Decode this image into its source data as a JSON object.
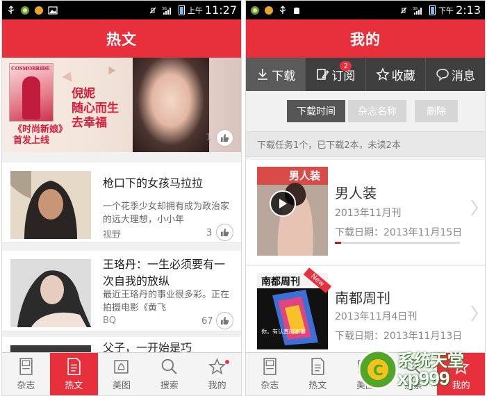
{
  "left_screen": {
    "statusbar": {
      "ampm": "上午",
      "time": "11:27"
    },
    "title": "热文",
    "banner": {
      "magazine_name": "COSMOBRIDE",
      "tagline_1": "倪妮",
      "tagline_2": "随心而生",
      "tagline_3": "去幸福",
      "subtitle_1": "《时尚新娘》",
      "subtitle_2": "首发上线",
      "likes": "1"
    },
    "articles": [
      {
        "title": "枪口下的女孩马拉拉",
        "description": "一个花季少女却拥有成为政治家的远大理想，小小年",
        "source": "视野",
        "likes": "3"
      },
      {
        "title": "王珞丹：一生必须要有一次自我的放纵",
        "description": "最近王珞丹的事业很多彩。正在拍摄电影《黄飞",
        "source": "BQ",
        "likes": "67"
      },
      {
        "title": "父子，一开始是巧"
      }
    ],
    "tabs": [
      {
        "label": "杂志",
        "icon": "magazine-icon"
      },
      {
        "label": "热文",
        "icon": "article-icon"
      },
      {
        "label": "美图",
        "icon": "picture-icon"
      },
      {
        "label": "搜索",
        "icon": "search-icon"
      },
      {
        "label": "我的",
        "icon": "star-icon"
      }
    ]
  },
  "right_screen": {
    "statusbar": {
      "ampm": "下午",
      "time": "2:13"
    },
    "title": "我的",
    "segments": [
      {
        "label": "下载",
        "icon": "download-icon"
      },
      {
        "label": "订阅",
        "icon": "subscribe-icon",
        "badge": "2"
      },
      {
        "label": "收藏",
        "icon": "star-icon"
      },
      {
        "label": "消息",
        "icon": "message-icon"
      }
    ],
    "sort": {
      "by_time": "下载时间",
      "by_name": "杂志名称",
      "delete": "删除"
    },
    "task_info": "下载任务1个，已下载2本，未读2本",
    "downloads": [
      {
        "cover_label": "男人装",
        "name": "男人装",
        "issue": "2013年11月刊",
        "date": "下载日期：2013年11月15日",
        "progress": 0.05
      },
      {
        "cover_label": "南都周刊",
        "cover_subtitle": "你，有认真的家事",
        "ribbon": "New",
        "name": "南都周刊",
        "issue": "2013年11月4日刊",
        "date": "下载日期：2013年11月13日"
      }
    ],
    "tabs": [
      {
        "label": "杂志",
        "icon": "magazine-icon"
      },
      {
        "label": "热文",
        "icon": "article-icon"
      },
      {
        "label": "美图",
        "icon": "picture-icon"
      },
      {
        "label": "搜索",
        "icon": "search-icon"
      },
      {
        "label": "我的",
        "icon": "star-icon"
      }
    ]
  },
  "watermark": {
    "line1": "系统天堂",
    "line2": "xp999"
  },
  "colors": {
    "accent": "#e8303c",
    "dark_bar": "#3f3f3f",
    "statusbar": "#000000"
  }
}
